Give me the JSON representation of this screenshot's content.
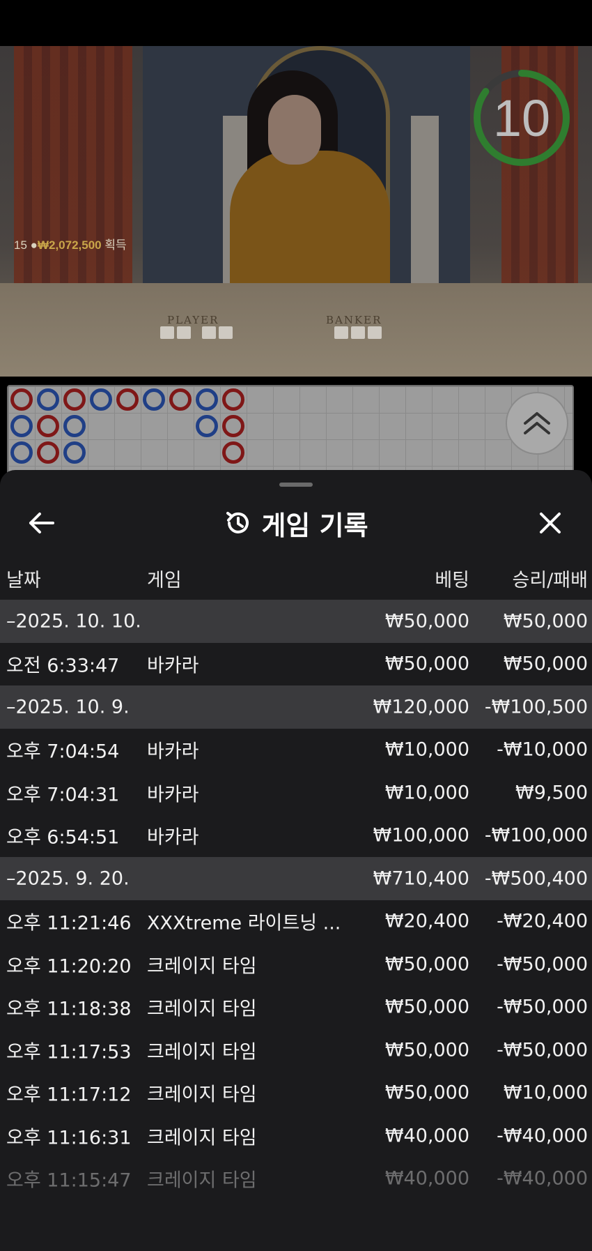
{
  "video": {
    "countdown": "10",
    "win_count": "15",
    "win_amount": "₩2,072,500",
    "win_suffix": "획득",
    "table_player": "PLAYER",
    "table_banker": "BANKER"
  },
  "roadmap": {
    "columns": [
      [
        "r",
        "b",
        "b"
      ],
      [
        "b",
        "r",
        "r"
      ],
      [
        "r",
        "b",
        "b"
      ],
      [
        "b"
      ],
      [
        "r"
      ],
      [
        "b"
      ],
      [
        "r"
      ],
      [
        "b",
        "b"
      ],
      [
        "r",
        "r",
        "r"
      ]
    ]
  },
  "sheet": {
    "title": "게임 기록",
    "columns": {
      "date": "날짜",
      "game": "게임",
      "bet": "베팅",
      "winloss": "승리/패배"
    },
    "rows": [
      {
        "type": "group",
        "date": "–2025. 10. 10.",
        "game": "",
        "bet": "₩50,000",
        "winloss": "₩50,000"
      },
      {
        "type": "item",
        "date": "오전 6:33:47",
        "game": "바카라",
        "bet": "₩50,000",
        "winloss": "₩50,000"
      },
      {
        "type": "group",
        "date": "–2025. 10. 9.",
        "game": "",
        "bet": "₩120,000",
        "winloss": "-₩100,500"
      },
      {
        "type": "item",
        "date": "오후 7:04:54",
        "game": "바카라",
        "bet": "₩10,000",
        "winloss": "-₩10,000"
      },
      {
        "type": "item",
        "date": "오후 7:04:31",
        "game": "바카라",
        "bet": "₩10,000",
        "winloss": "₩9,500"
      },
      {
        "type": "item",
        "date": "오후 6:54:51",
        "game": "바카라",
        "bet": "₩100,000",
        "winloss": "-₩100,000"
      },
      {
        "type": "group",
        "date": "–2025. 9. 20.",
        "game": "",
        "bet": "₩710,400",
        "winloss": "-₩500,400"
      },
      {
        "type": "item",
        "date": "오후 11:21:46",
        "game": "XXXtreme 라이트닝 ...",
        "bet": "₩20,400",
        "winloss": "-₩20,400"
      },
      {
        "type": "item",
        "date": "오후 11:20:20",
        "game": "크레이지 타임",
        "bet": "₩50,000",
        "winloss": "-₩50,000"
      },
      {
        "type": "item",
        "date": "오후 11:18:38",
        "game": "크레이지 타임",
        "bet": "₩50,000",
        "winloss": "-₩50,000"
      },
      {
        "type": "item",
        "date": "오후 11:17:53",
        "game": "크레이지 타임",
        "bet": "₩50,000",
        "winloss": "-₩50,000"
      },
      {
        "type": "item",
        "date": "오후 11:17:12",
        "game": "크레이지 타임",
        "bet": "₩50,000",
        "winloss": "₩10,000"
      },
      {
        "type": "item",
        "date": "오후 11:16:31",
        "game": "크레이지 타임",
        "bet": "₩40,000",
        "winloss": "-₩40,000"
      },
      {
        "type": "item",
        "date": "오후 11:15:47",
        "game": "크레이지 타임",
        "bet": "₩40,000",
        "winloss": "-₩40,000"
      }
    ]
  },
  "colors": {
    "banker_red": "#7f1717",
    "player_blue": "#203f86",
    "timer_green": "#2f7d2f",
    "sheet_bg": "#1b1b1d",
    "group_bg": "#3a3a3d"
  },
  "icons": {
    "back": "arrow-left-icon",
    "history": "history-clock-icon",
    "close": "close-icon",
    "expand": "chevron-double-up-icon"
  }
}
